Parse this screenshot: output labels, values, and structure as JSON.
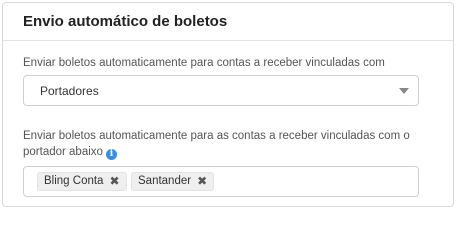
{
  "section": {
    "title": "Envio automático de boletos"
  },
  "auto_send": {
    "label": "Enviar boletos automaticamente para contas a receber vinculadas com",
    "selected": "Portadores"
  },
  "carriers": {
    "label": "Enviar boletos automaticamente para as contas a receber vinculadas com o portador abaixo",
    "info_icon": "info-icon",
    "tags": [
      {
        "label": "Bling Conta",
        "remove": "✖"
      },
      {
        "label": "Santander",
        "remove": "✖"
      }
    ]
  },
  "colors": {
    "info_icon": "#3b8fe0",
    "tag_background": "#efefef",
    "border": "#cfcfcf"
  }
}
